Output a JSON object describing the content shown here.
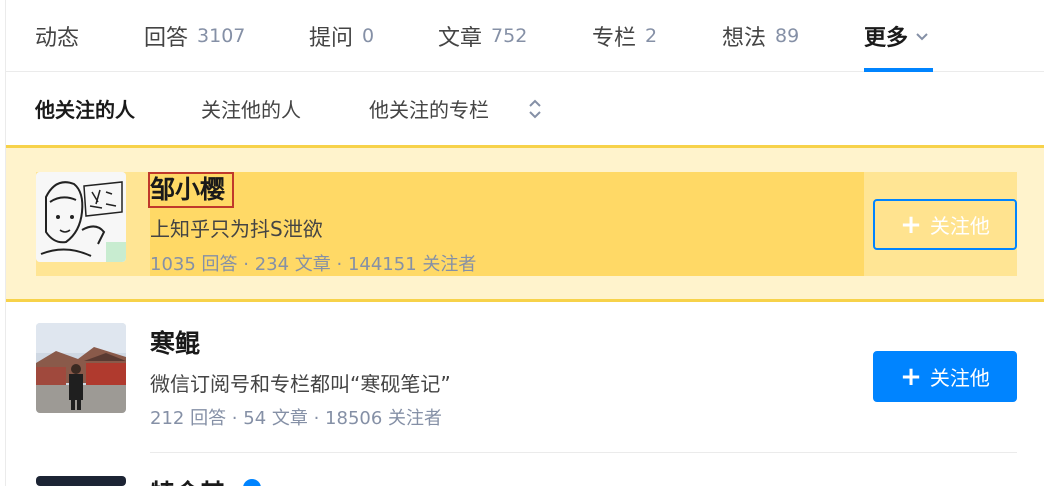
{
  "tabs": [
    {
      "label": "动态",
      "count": ""
    },
    {
      "label": "回答",
      "count": "3107"
    },
    {
      "label": "提问",
      "count": "0"
    },
    {
      "label": "文章",
      "count": "752"
    },
    {
      "label": "专栏",
      "count": "2"
    },
    {
      "label": "想法",
      "count": "89"
    },
    {
      "label": "更多",
      "count": ""
    }
  ],
  "subtabs": {
    "following": "他关注的人",
    "followers": "关注他的人",
    "columns": "他关注的专栏"
  },
  "users": [
    {
      "name": "邹小樱",
      "bio": "上知乎只为抖S泄欲",
      "stats": "1035 回答 · 234 文章 · 144151 关注者",
      "button": "关注他"
    },
    {
      "name": "寒鲲",
      "bio": "微信订阅号和专栏都叫“寒砚笔记”",
      "stats": "212 回答 · 54 文章 · 18506 关注者",
      "button": "关注他"
    },
    {
      "name": "特命其"
    }
  ],
  "colors": {
    "accent": "#0084ff",
    "highlight": "#ffd966",
    "highlight_bg": "#fff3cc",
    "muted": "#8590a6"
  }
}
